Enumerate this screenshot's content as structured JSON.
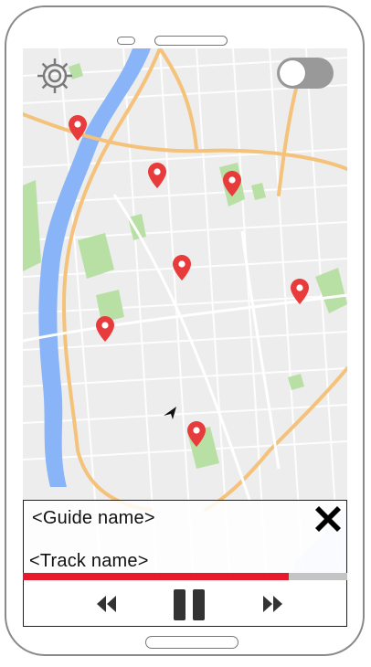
{
  "panel": {
    "guide_name": "<Guide name>",
    "track_name": "<Track name>"
  },
  "progress": {
    "fraction": 0.82
  },
  "toggle": {
    "state": "off"
  },
  "icons": {
    "settings": "gear-icon",
    "close": "close-icon",
    "rewind": "rewind-icon",
    "pause": "pause-icon",
    "forward": "fast-forward-icon",
    "pin": "map-pin-icon",
    "location": "navigation-arrow-icon"
  },
  "colors": {
    "pin": "#e83b3b",
    "progress_fill": "#e8192c",
    "progress_track": "#c4c4c4",
    "water": "#8ab4f8",
    "park": "#b8e0a4",
    "highway": "#f4c27a"
  }
}
